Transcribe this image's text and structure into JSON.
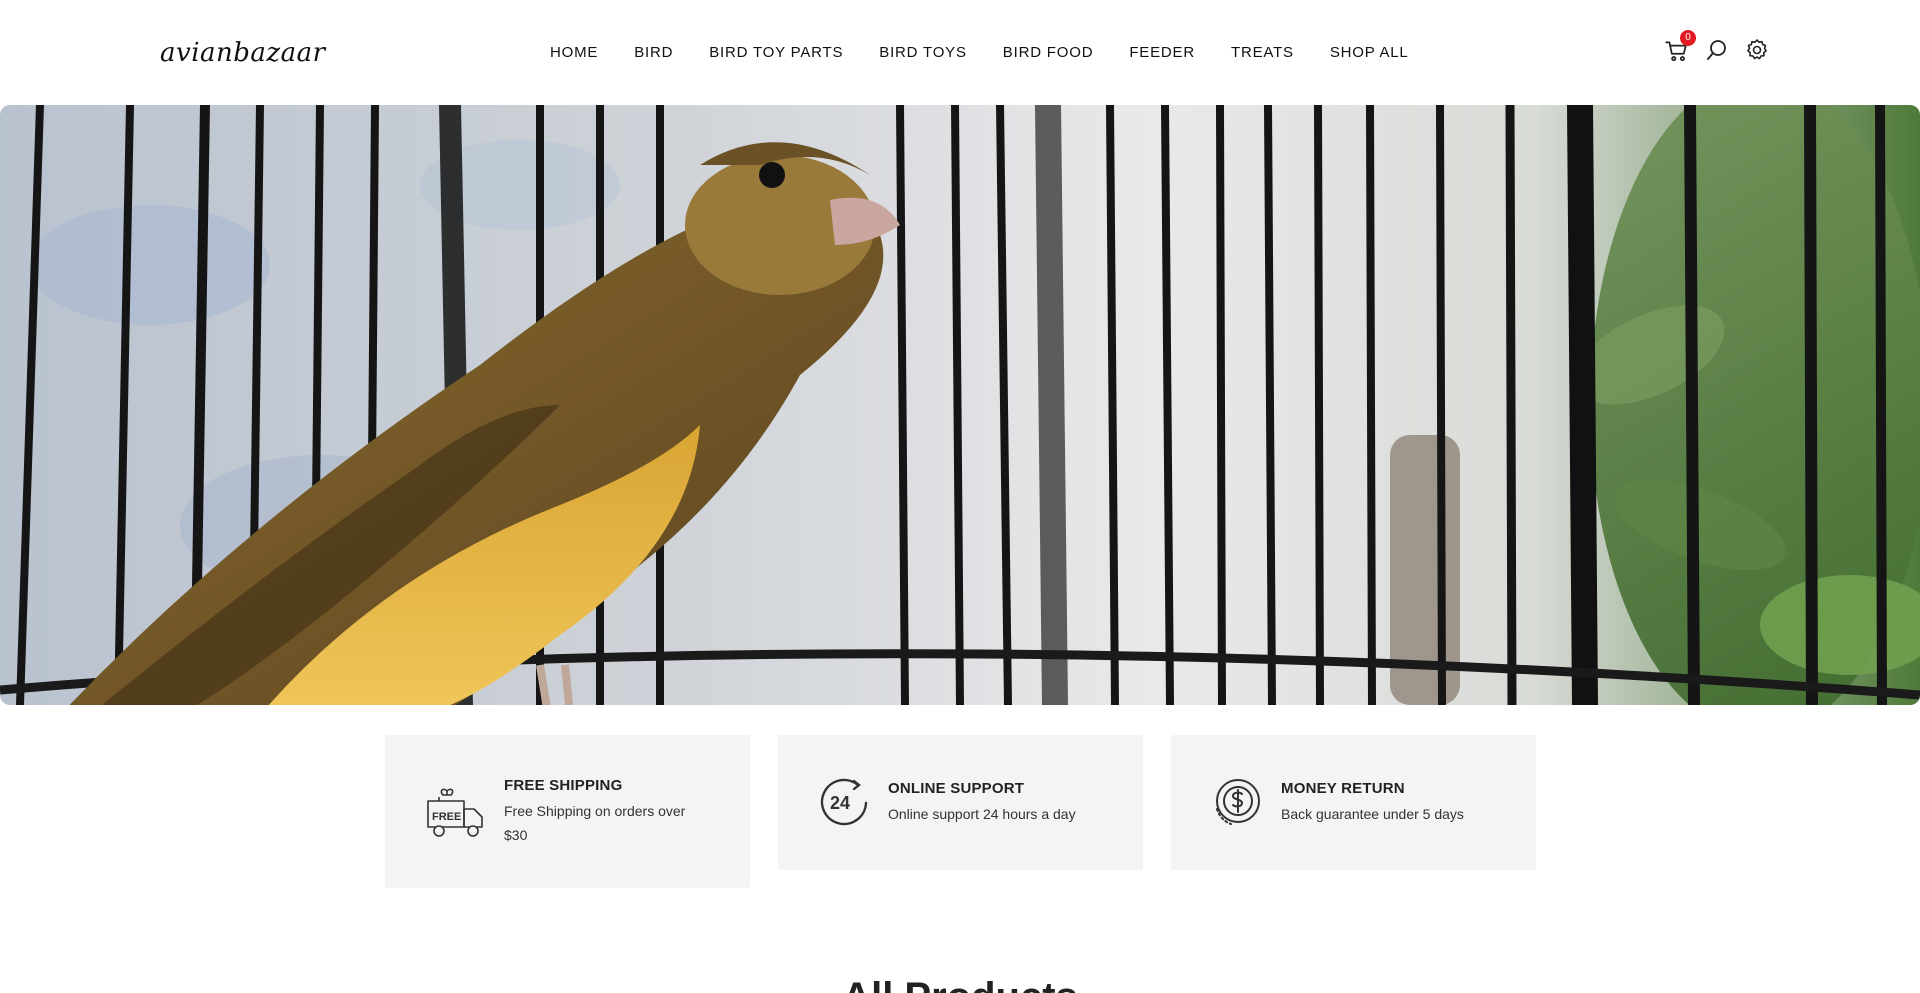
{
  "brand": {
    "logo_text": "avianbazaar"
  },
  "nav": {
    "items": [
      {
        "label": "HOME"
      },
      {
        "label": "BIRD"
      },
      {
        "label": "BIRD TOY PARTS"
      },
      {
        "label": "BIRD TOYS"
      },
      {
        "label": "BIRD FOOD"
      },
      {
        "label": "FEEDER"
      },
      {
        "label": "TREATS"
      },
      {
        "label": "SHOP ALL"
      }
    ]
  },
  "header_icons": {
    "cart_icon": "cart-icon",
    "cart_count": "0",
    "search_icon": "search-icon",
    "settings_icon": "gear-icon"
  },
  "hero": {
    "image": "canary-in-cage"
  },
  "features": [
    {
      "icon": "free-shipping-truck-icon",
      "title": "FREE SHIPPING",
      "desc": "Free Shipping on orders over $30"
    },
    {
      "icon": "24-hour-support-icon",
      "title": "ONLINE SUPPORT",
      "desc": "Online support 24 hours a day"
    },
    {
      "icon": "money-return-icon",
      "title": "MONEY RETURN",
      "desc": "Back guarantee under 5 days"
    }
  ],
  "sections": {
    "all_products_title": "All Products"
  },
  "colors": {
    "badge": "#e21b23",
    "feature_bg": "#f3f4f6",
    "text": "#222222"
  }
}
